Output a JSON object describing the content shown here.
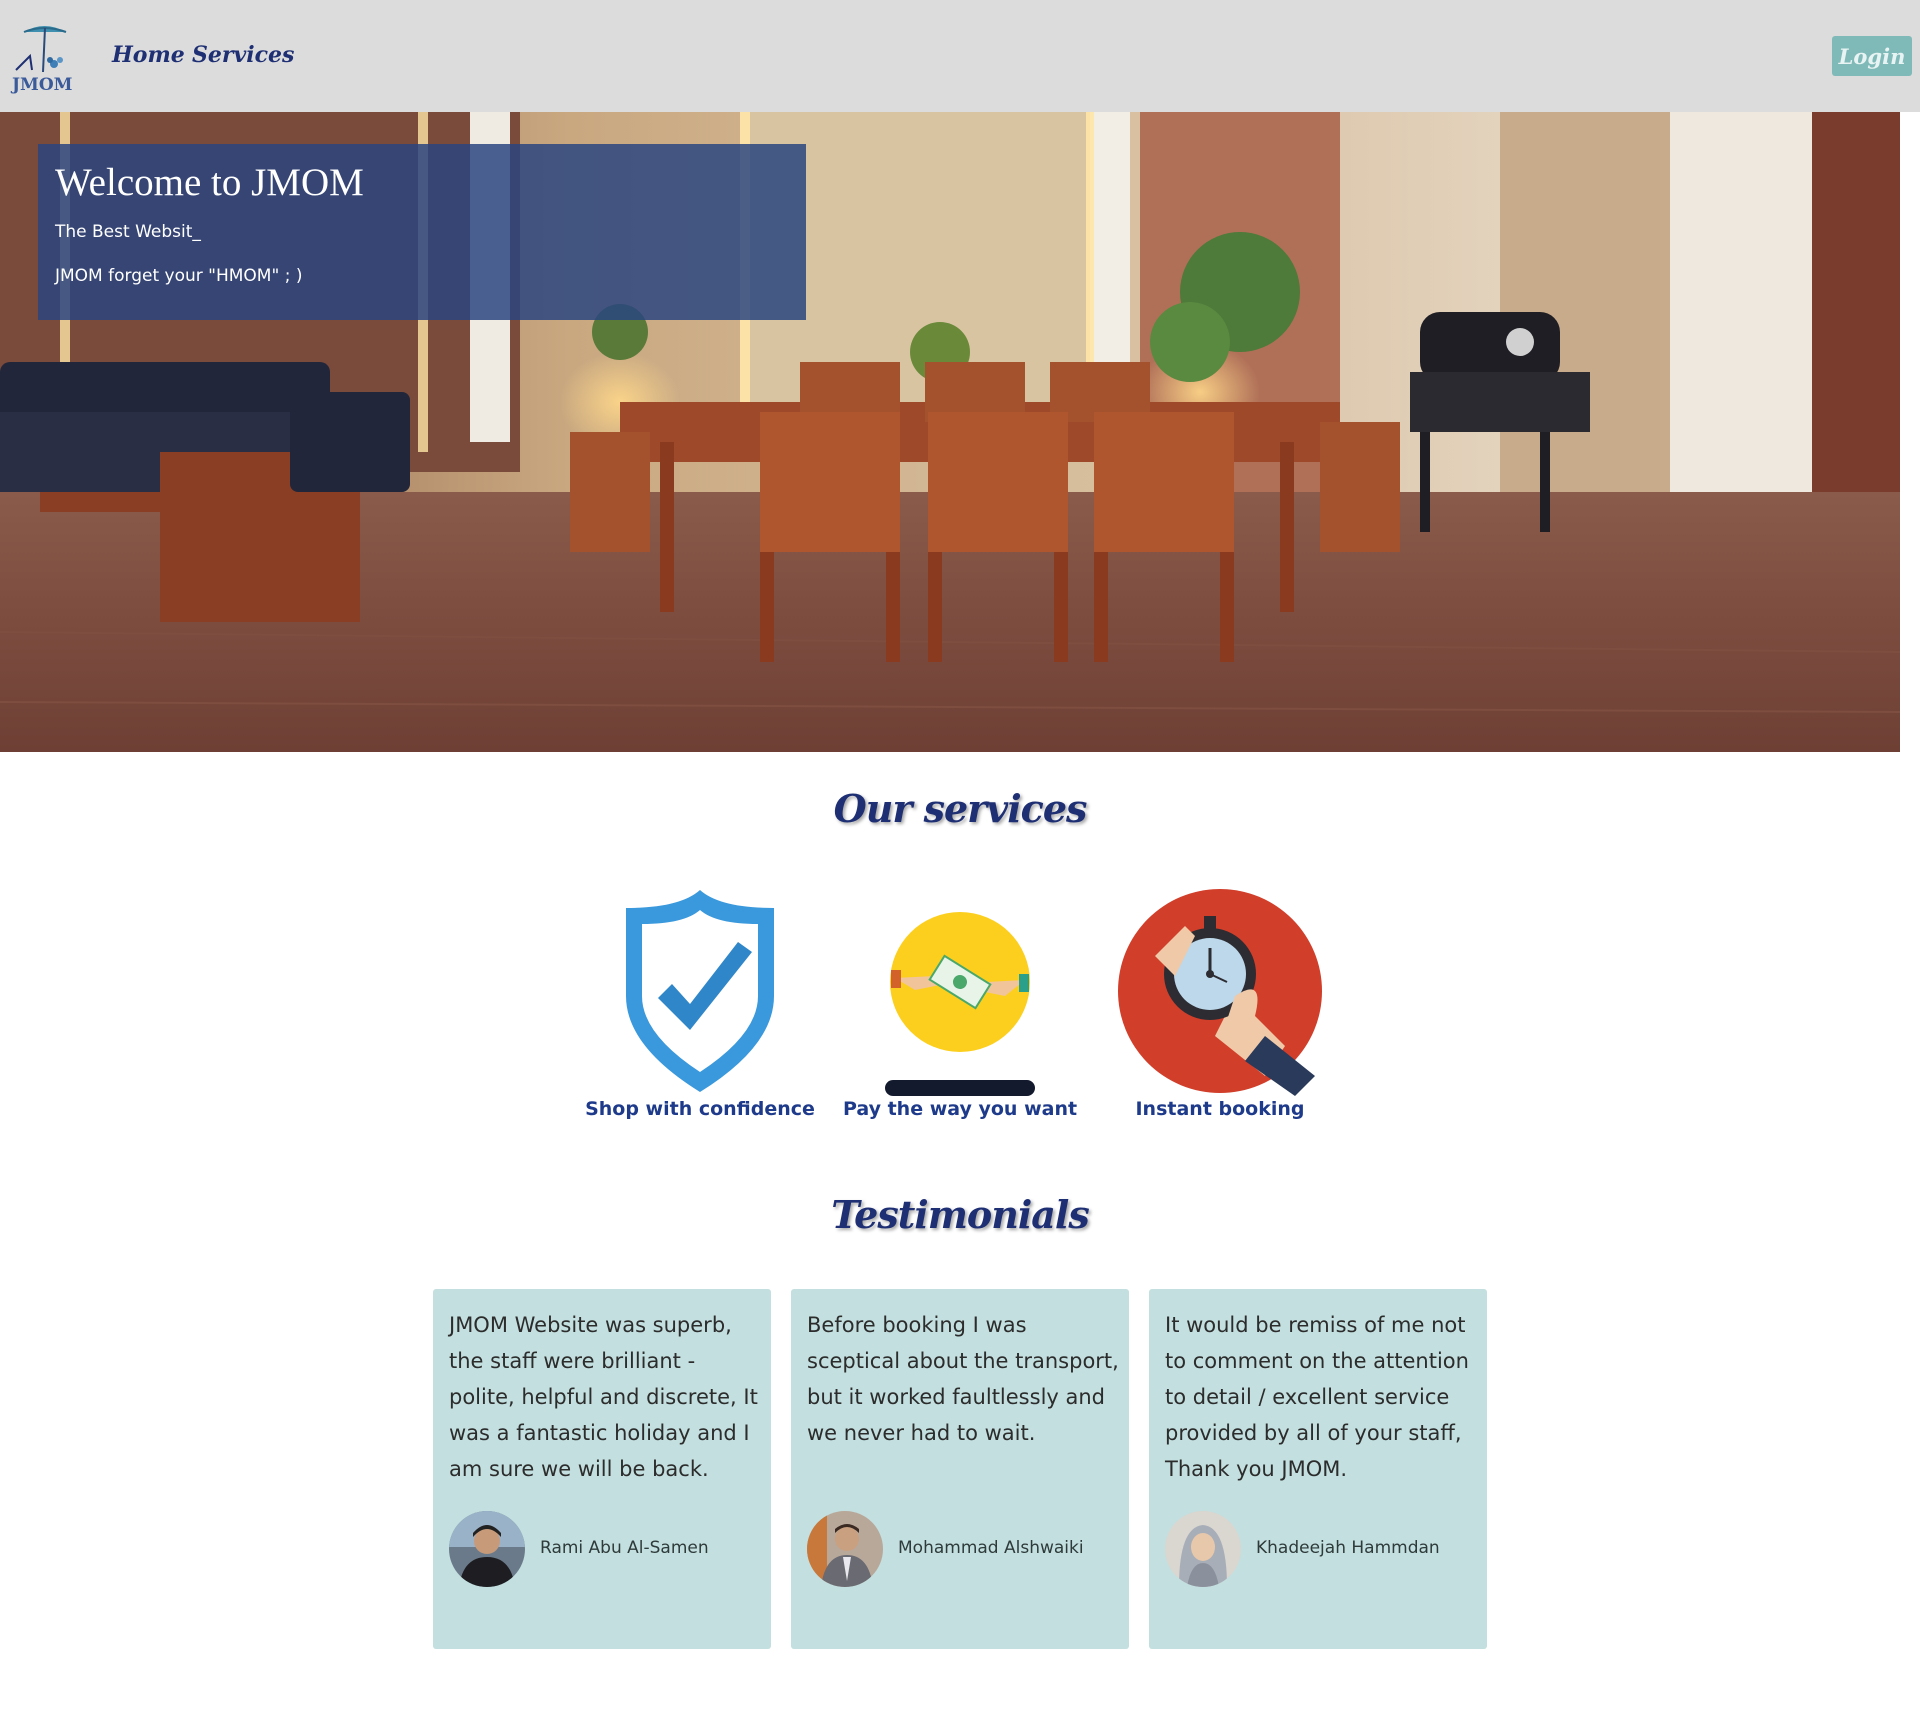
{
  "navbar": {
    "logo_text": "JMOM",
    "links": [
      "Home",
      "Services"
    ],
    "login_label": "Login"
  },
  "hero": {
    "title": "Welcome to JMOM",
    "subtitle1": "The Best Websit_",
    "subtitle2": "JMOM forget your \"HMOM\" ; )"
  },
  "services": {
    "heading": "Our services",
    "items": [
      {
        "label": "Shop with confidence",
        "icon": "shield-check-icon"
      },
      {
        "label": "Pay the way you want",
        "icon": "money-exchange-icon"
      },
      {
        "label": "Instant booking",
        "icon": "stopwatch-hand-icon"
      }
    ]
  },
  "testimonials": {
    "heading": "Testimonials",
    "items": [
      {
        "text": "JMOM Website was superb, the staff were brilliant - polite, helpful and discrete, It was a fantastic holiday and I am sure we will be back.",
        "name": "Rami Abu Al-Samen"
      },
      {
        "text": "Before booking I was sceptical about the transport, but it worked faultlessly and we never had to wait.",
        "name": "Mohammad Alshwaiki"
      },
      {
        "text": "It would be remiss of me not to comment on the attention to detail / excellent service provided by all of your staff, Thank you JMOM.",
        "name": "Khadeejah Hammdan"
      }
    ]
  },
  "colors": {
    "navbar_bg": "#dcdcdc",
    "nav_text": "#1e2f73",
    "login_bg": "#7fbab9",
    "hero_overlay": "#284480",
    "service_label": "#1e3a8a",
    "card_bg": "#c3dfdf"
  }
}
